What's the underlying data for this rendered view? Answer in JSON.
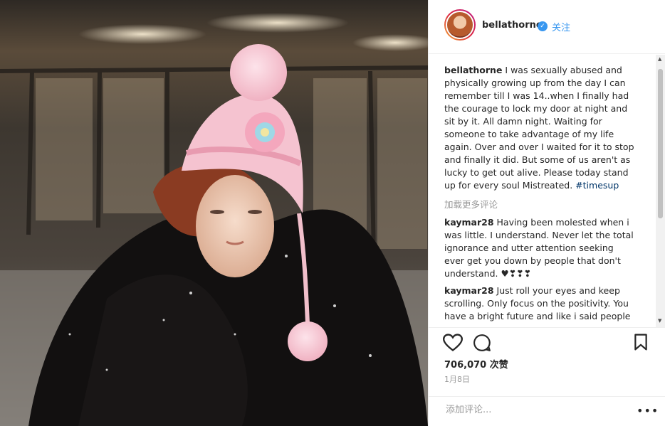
{
  "post": {
    "photo_alt": "",
    "header": {
      "username": "bellathorne",
      "follow_label": "关注"
    },
    "caption": {
      "username": "bellathorne",
      "text": " I was sexually abused and physically growing up from the day I can remember till I was 14..when I finally had the courage to lock my door at night and sit by it. All damn night. Waiting for someone to take advantage of my life again. Over and over I waited for it to stop and finally it did. But some of us aren't as lucky to get out alive. Please today stand up for every soul Mistreated. ",
      "hashtag": "#timesup"
    },
    "load_more": "加载更多评论",
    "comments": [
      {
        "username": "kaymar28",
        "text": " Having been molested when i was little. I understand. Never let the total ignorance and utter attention seeking ever get you down by people that don't understand. ♥❣❣❣"
      },
      {
        "username": "kaymar28",
        "text": " Just roll your eyes and keep scrolling. Only focus on the positivity. You have a bright future and like i said people"
      }
    ],
    "likes_count": "706,070",
    "likes_label": "次赞",
    "date": "1月8日",
    "add_comment_placeholder": "添加评论...",
    "more_options": "•••"
  },
  "icons": {
    "verified": "verified-badge-icon",
    "like": "heart-icon",
    "comment": "comment-bubble-icon",
    "save": "bookmark-icon"
  },
  "colors": {
    "link_blue": "#3897f0",
    "hashtag": "#003569",
    "text": "#262626",
    "muted": "#999999",
    "hat_pink": "#f6c6d3"
  }
}
